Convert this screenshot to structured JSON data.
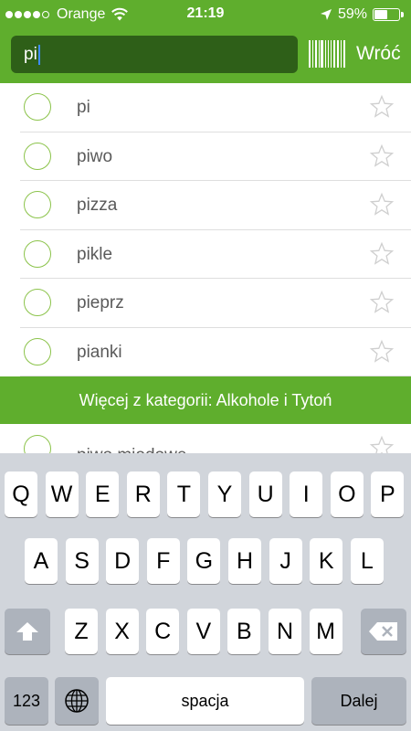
{
  "status_bar": {
    "carrier": "Orange",
    "time": "21:19",
    "battery": "59%",
    "battery_level": 0.59,
    "signal_bars": 4,
    "signal_total": 5
  },
  "search": {
    "value": "pi"
  },
  "header": {
    "back_label": "Wróć"
  },
  "results": [
    {
      "label": "pi"
    },
    {
      "label": "piwo"
    },
    {
      "label": "pizza"
    },
    {
      "label": "pikle"
    },
    {
      "label": "pieprz"
    },
    {
      "label": "pianki"
    }
  ],
  "category_banner": "Więcej z kategorii: Alkohole i Tytoń",
  "category_results": [
    {
      "label": "piwo miodowe"
    }
  ],
  "keyboard": {
    "row1": [
      "Q",
      "W",
      "E",
      "R",
      "T",
      "Y",
      "U",
      "I",
      "O",
      "P"
    ],
    "row2": [
      "A",
      "S",
      "D",
      "F",
      "G",
      "H",
      "J",
      "K",
      "L"
    ],
    "row3": [
      "Z",
      "X",
      "C",
      "V",
      "B",
      "N",
      "M"
    ],
    "numbers_label": "123",
    "space_label": "spacja",
    "return_label": "Dalej"
  },
  "colors": {
    "accent": "#5fae2d",
    "search_bg": "#2e5f18",
    "check_outline": "#8bc34a"
  }
}
